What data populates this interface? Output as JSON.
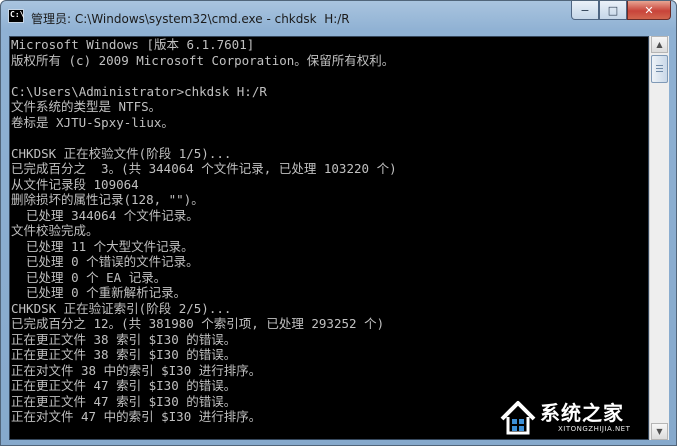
{
  "window": {
    "title": "管理员: C:\\Windows\\system32\\cmd.exe - chkdsk  H:/R",
    "icon_label": "C:\\",
    "controls": {
      "minimize": "−",
      "maximize": "□",
      "close": "✕"
    }
  },
  "console": {
    "lines": [
      "Microsoft Windows [版本 6.1.7601]",
      "版权所有 (c) 2009 Microsoft Corporation。保留所有权利。",
      "",
      "C:\\Users\\Administrator>chkdsk H:/R",
      "文件系统的类型是 NTFS。",
      "卷标是 XJTU-Spxy-liux。",
      "",
      "CHKDSK 正在校验文件(阶段 1/5)...",
      "已完成百分之  3。(共 344064 个文件记录, 已处理 103220 个)",
      "从文件记录段 109064",
      "删除损坏的属性记录(128, \"\")。",
      "  已处理 344064 个文件记录。",
      "文件校验完成。",
      "  已处理 11 个大型文件记录。",
      "  已处理 0 个错误的文件记录。",
      "  已处理 0 个 EA 记录。",
      "  已处理 0 个重新解析记录。",
      "CHKDSK 正在验证索引(阶段 2/5)...",
      "已完成百分之 12。(共 381980 个索引项, 已处理 293252 个)",
      "正在更正文件 38 索引 $I30 的错误。",
      "正在更正文件 38 索引 $I30 的错误。",
      "正在对文件 38 中的索引 $I30 进行排序。",
      "正在更正文件 47 索引 $I30 的错误。",
      "正在更正文件 47 索引 $I30 的错误。",
      "正在对文件 47 中的索引 $I30 进行排序。"
    ]
  },
  "scrollbar": {
    "up_icon": "arrow-up-icon",
    "down_icon": "arrow-down-icon"
  },
  "watermark": {
    "name": "系统之家",
    "domain": "XITONGZHIJIA.NET"
  },
  "colors": {
    "console_bg": "#000000",
    "console_text": "#c0c0c0",
    "titlebar": "#a9c4df",
    "close_button": "#c8443a"
  }
}
